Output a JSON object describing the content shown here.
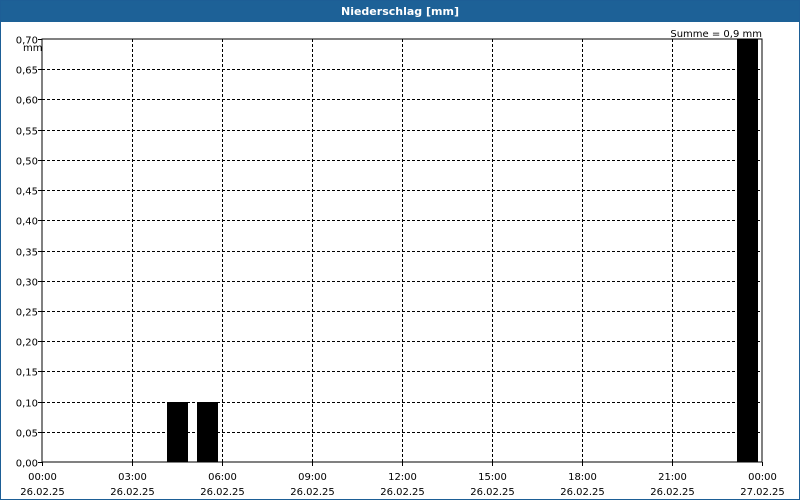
{
  "window": {
    "title": "Niederschlag [mm]"
  },
  "chart_data": {
    "type": "bar",
    "title": "Niederschlag [mm]",
    "ylabel": "mm",
    "xlabel": "",
    "summary": "Summe = 0,9 mm",
    "ylim": [
      0,
      0.7
    ],
    "yticks": [
      "0,00",
      "0,05",
      "0,10",
      "0,15",
      "0,20",
      "0,25",
      "0,30",
      "0,35",
      "0,40",
      "0,45",
      "0,50",
      "0,55",
      "0,60",
      "0,65",
      "0,70"
    ],
    "xlim_hours": [
      0,
      24
    ],
    "xticks": [
      {
        "time": "00:00",
        "date": "26.02.25"
      },
      {
        "time": "03:00",
        "date": "26.02.25"
      },
      {
        "time": "06:00",
        "date": "26.02.25"
      },
      {
        "time": "09:00",
        "date": "26.02.25"
      },
      {
        "time": "12:00",
        "date": "26.02.25"
      },
      {
        "time": "15:00",
        "date": "26.02.25"
      },
      {
        "time": "18:00",
        "date": "26.02.25"
      },
      {
        "time": "21:00",
        "date": "26.02.25"
      },
      {
        "time": "00:00",
        "date": "27.02.25"
      }
    ],
    "series": [
      {
        "color": "#000000",
        "points": [
          {
            "hour": 4.5,
            "value": 0.1
          },
          {
            "hour": 5.5,
            "value": 0.1
          },
          {
            "hour": 23.5,
            "value": 0.7
          }
        ]
      }
    ],
    "grid": true
  }
}
